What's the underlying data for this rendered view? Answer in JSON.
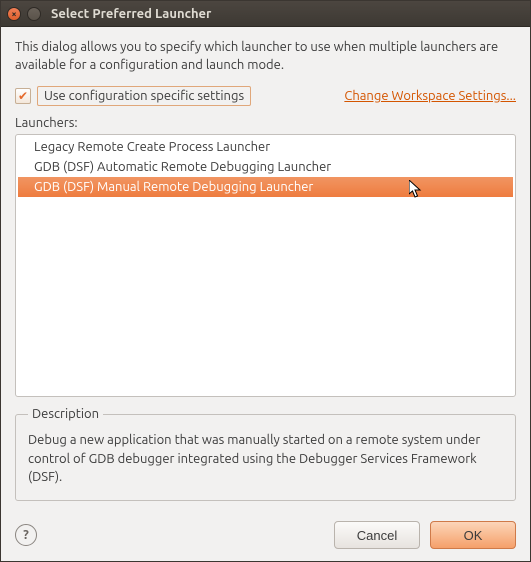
{
  "window": {
    "title": "Select Preferred Launcher"
  },
  "dialog": {
    "intro": "This dialog allows you to specify which launcher to use when multiple launchers are available for a configuration and launch mode.",
    "use_config_label": "Use configuration specific settings",
    "use_config_checked": true,
    "workspace_link": "Change Workspace Settings...",
    "launchers_label": "Launchers:",
    "launchers": [
      {
        "name": "Legacy Remote Create Process Launcher",
        "selected": false
      },
      {
        "name": "GDB (DSF) Automatic Remote Debugging Launcher",
        "selected": false
      },
      {
        "name": "GDB (DSF) Manual Remote Debugging Launcher",
        "selected": true
      }
    ],
    "description_title": "Description",
    "description_text": "Debug a new application that was manually started on a remote system under control of GDB debugger integrated using the Debugger Services Framework (DSF)."
  },
  "buttons": {
    "cancel": "Cancel",
    "ok": "OK"
  }
}
